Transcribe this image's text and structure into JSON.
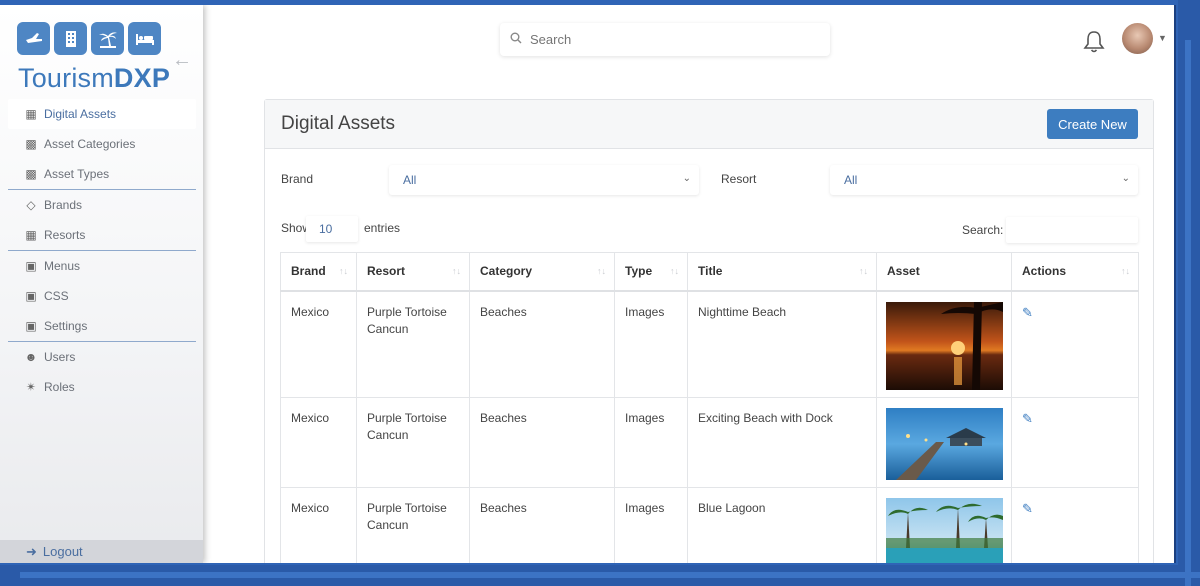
{
  "app": {
    "name_part1": "Tourism",
    "name_part2": "DXP"
  },
  "sidebar": {
    "items": [
      {
        "label": "Digital Assets",
        "icon": "crop-icon"
      },
      {
        "label": "Asset Categories",
        "icon": "images-icon"
      },
      {
        "label": "Asset Types",
        "icon": "images-icon"
      },
      {
        "label": "Brands",
        "icon": "diamond-icon"
      },
      {
        "label": "Resorts",
        "icon": "building-icon"
      },
      {
        "label": "Menus",
        "icon": "menu-icon"
      },
      {
        "label": "CSS",
        "icon": "css-icon"
      },
      {
        "label": "Settings",
        "icon": "settings-icon"
      },
      {
        "label": "Users",
        "icon": "users-icon"
      },
      {
        "label": "Roles",
        "icon": "roles-icon"
      }
    ],
    "logout_label": "Logout"
  },
  "topbar": {
    "search_placeholder": "Search"
  },
  "panel": {
    "title": "Digital Assets",
    "create_label": "Create New",
    "brand_label": "Brand",
    "brand_value": "All",
    "resort_label": "Resort",
    "resort_value": "All",
    "show_label": "Show",
    "show_value": "10",
    "entries_label": "entries",
    "search_label": "Search:"
  },
  "table": {
    "headers": [
      "Brand",
      "Resort",
      "Category",
      "Type",
      "Title",
      "Asset",
      "Actions"
    ],
    "rows": [
      {
        "brand": "Mexico",
        "resort_line1": "Purple Tortoise",
        "resort_line2": "Cancun",
        "category": "Beaches",
        "type": "Images",
        "title": "Nighttime Beach"
      },
      {
        "brand": "Mexico",
        "resort_line1": "Purple Tortoise",
        "resort_line2": "Cancun",
        "category": "Beaches",
        "type": "Images",
        "title": "Exciting Beach with Dock"
      },
      {
        "brand": "Mexico",
        "resort_line1": "Purple Tortoise",
        "resort_line2": "Cancun",
        "category": "Beaches",
        "type": "Images",
        "title": "Blue Lagoon"
      }
    ]
  },
  "colors": {
    "accent": "#3d7dc0",
    "frame": "#2f64b6"
  }
}
